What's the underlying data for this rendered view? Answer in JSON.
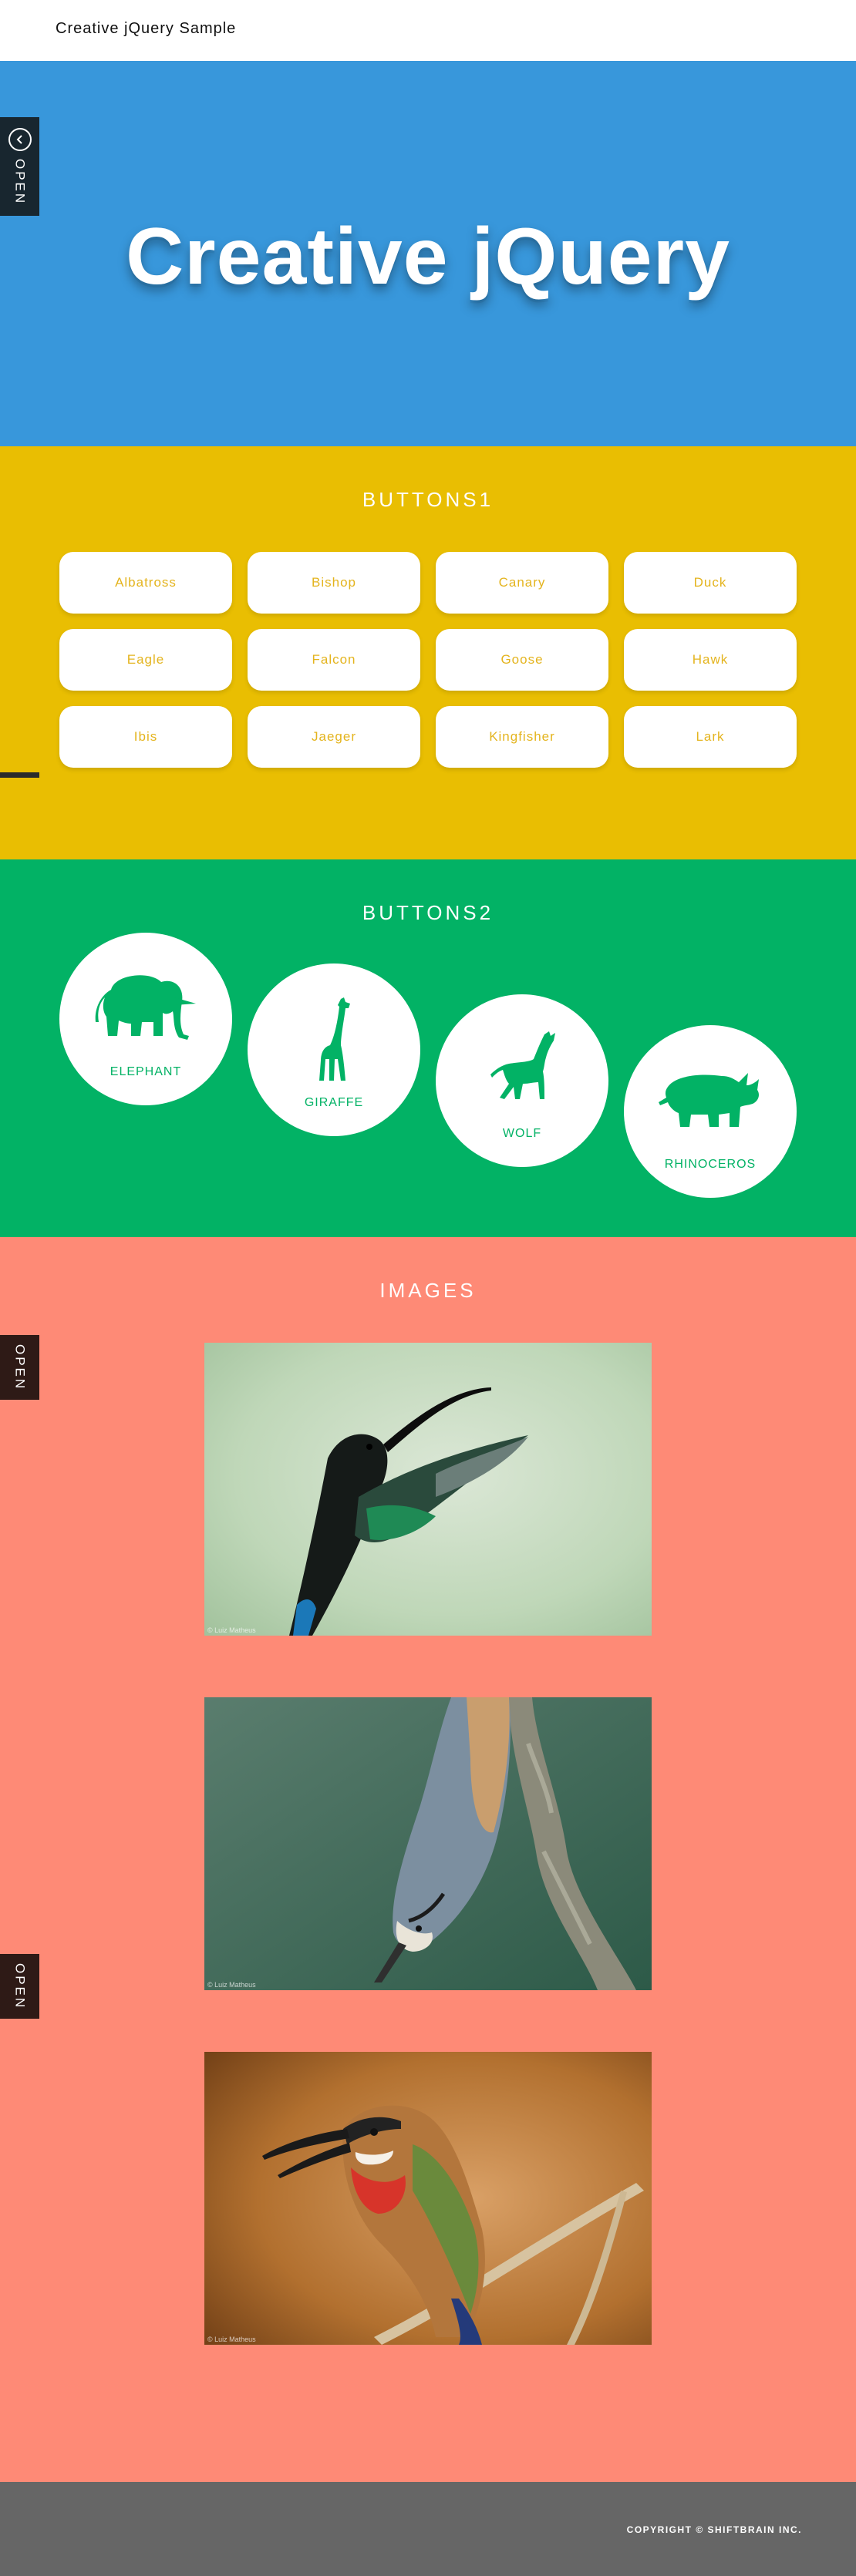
{
  "header": {
    "site_title": "Creative jQuery Sample"
  },
  "hero": {
    "title": "Creative jQuery",
    "bg_color": "#3897db"
  },
  "side_tabs": {
    "label": "OPEN",
    "icon": "chevron-left-circle-icon"
  },
  "buttons1": {
    "title": "BUTTONS1",
    "bg_color": "#e9be02",
    "text_color": "#e4b41e",
    "items": [
      "Albatross",
      "Bishop",
      "Canary",
      "Duck",
      "Eagle",
      "Falcon",
      "Goose",
      "Hawk",
      "Ibis",
      "Jaeger",
      "Kingfisher",
      "Lark"
    ]
  },
  "buttons2": {
    "title": "BUTTONS2",
    "bg_color": "#02b265",
    "text_color": "#02b265",
    "items": [
      {
        "label": "ELEPHANT",
        "icon": "elephant-icon"
      },
      {
        "label": "GIRAFFE",
        "icon": "giraffe-icon"
      },
      {
        "label": "WOLF",
        "icon": "wolf-icon"
      },
      {
        "label": "RHINOCEROS",
        "icon": "rhinoceros-icon"
      }
    ]
  },
  "images": {
    "title": "IMAGES",
    "bg_color": "#fe8a76",
    "photos": [
      {
        "subject": "hummingbird",
        "credit": "© Luiz Matheus"
      },
      {
        "subject": "nuthatch",
        "credit": "© Luiz Matheus"
      },
      {
        "subject": "bee-eater",
        "credit": "© Luiz Matheus"
      }
    ]
  },
  "footer": {
    "copyright": "COPYRIGHT © SHIFTBRAIN INC.",
    "bg_color": "#666666"
  }
}
